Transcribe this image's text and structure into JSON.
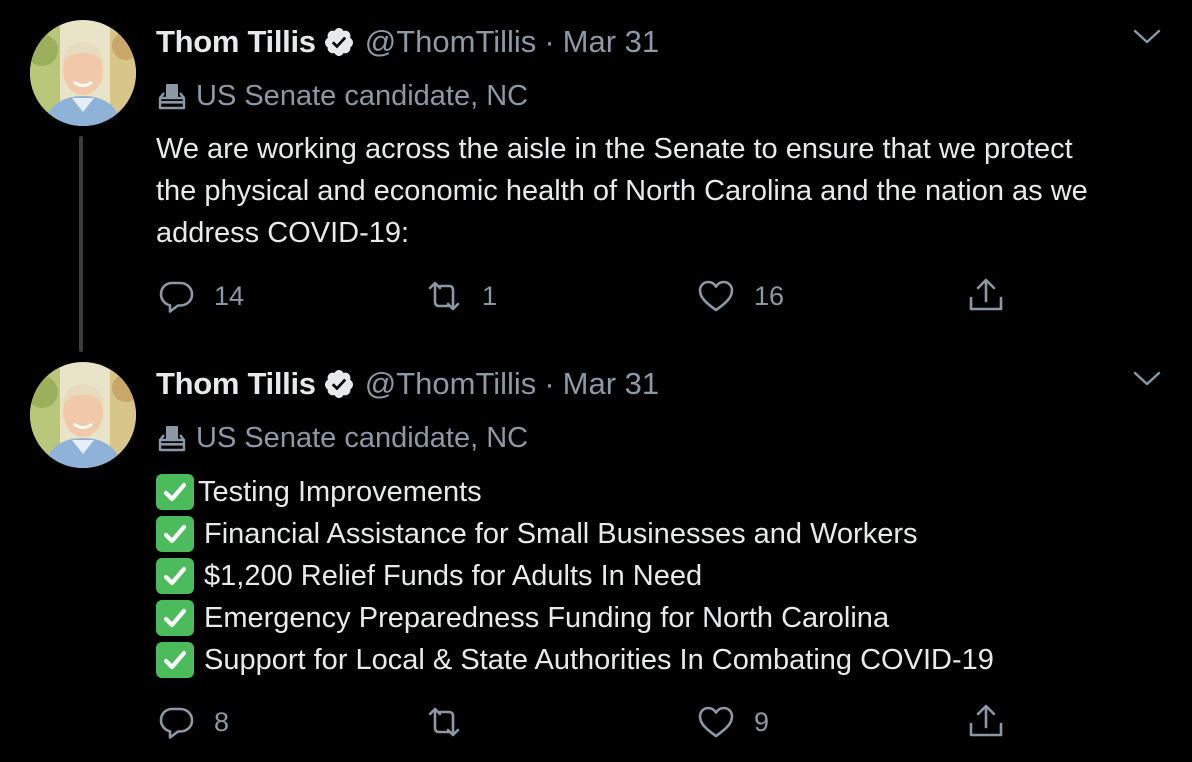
{
  "tweets": [
    {
      "author": {
        "name": "Thom Tillis",
        "handle": "@ThomTillis",
        "verified": true,
        "avatar_icon": "profile-photo"
      },
      "separator": "·",
      "date": "Mar 31",
      "label": "US Senate candidate, NC",
      "text_lines": [
        "We are working across the aisle in the Senate to ensure that we protect",
        "the physical and economic health of North Carolina and the nation as we",
        "address COVID-19:"
      ],
      "actions": {
        "replies": "14",
        "retweets": "1",
        "likes": "16"
      }
    },
    {
      "author": {
        "name": "Thom Tillis",
        "handle": "@ThomTillis",
        "verified": true,
        "avatar_icon": "profile-photo"
      },
      "separator": "·",
      "date": "Mar 31",
      "label": "US Senate candidate, NC",
      "checklist": [
        "Testing Improvements",
        "Financial Assistance for Small Businesses and Workers",
        "$1,200 Relief Funds for Adults In Need",
        "Emergency Preparedness Funding for North Carolina",
        "Support for Local & State Authorities In Combating COVID-19"
      ],
      "actions": {
        "replies": "8",
        "retweets": "",
        "likes": "9"
      }
    }
  ],
  "colors": {
    "background": "#000000",
    "secondary_text": "#8b98a5",
    "primary_text": "#e7e9ea",
    "checkmark_green": "#4cbb5c"
  }
}
